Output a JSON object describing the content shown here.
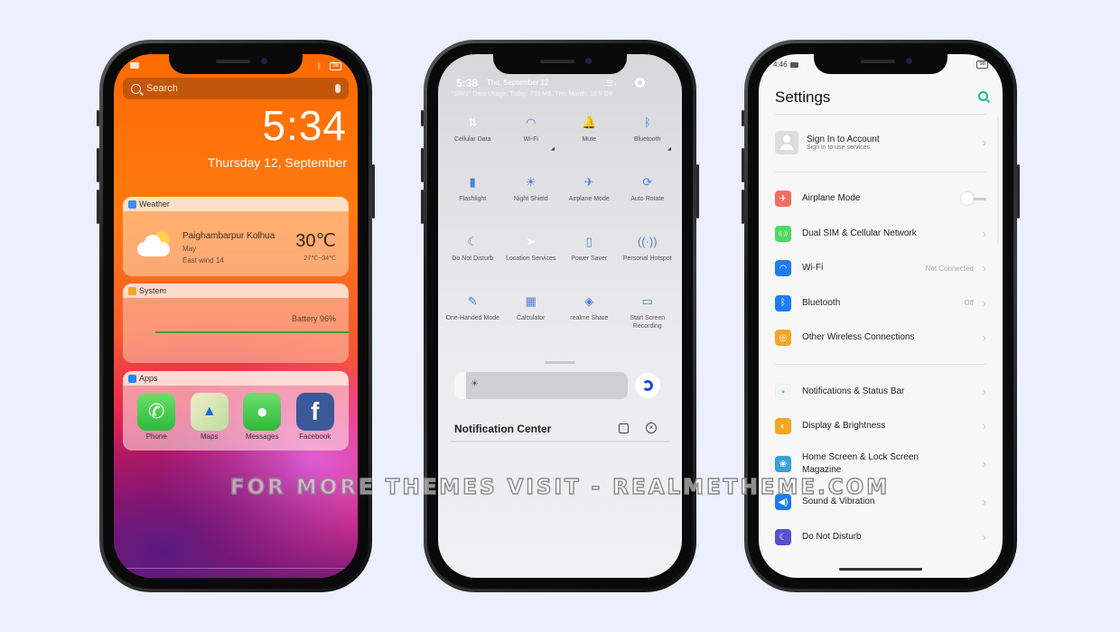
{
  "watermark": "FOR MORE THEMES VISIT - REALMETHEME.COM",
  "phone1": {
    "status": {
      "battery": "96",
      "bluetooth_icon": "bluetooth-icon"
    },
    "search": {
      "placeholder": "Search"
    },
    "clock": "5:34",
    "date": "Thursday 12, September",
    "weather": {
      "header": "Weather",
      "city": "Paighambarpur Kolhua",
      "condition": "May",
      "wind": "East wind 14",
      "temperature": "30℃",
      "range": "27℃~34℃"
    },
    "system": {
      "header": "System",
      "battery_label": "Battery 96%",
      "battery_percent": 96
    },
    "apps": {
      "header": "Apps",
      "items": [
        {
          "label": "Phone",
          "icon": "phone-icon",
          "color": "#34c759"
        },
        {
          "label": "Maps",
          "icon": "maps-icon",
          "color": "#f2e7c8"
        },
        {
          "label": "Messages",
          "icon": "messages-icon",
          "color": "#34c759"
        },
        {
          "label": "Facebook",
          "icon": "facebook-icon",
          "color": "#3b5998"
        }
      ]
    }
  },
  "phone2": {
    "time": "5:38",
    "date": "Thu, September 12",
    "data_usage": "\"SIM1\" Data Usage, Today: 733 MB, This Month: 10.5 GB",
    "tiles": [
      {
        "label": "Cellular Data",
        "glyph": "⇅",
        "icon": "cellular-data-icon",
        "active": false
      },
      {
        "label": "Wi-Fi",
        "glyph": "◠",
        "icon": "wifi-icon",
        "active": true,
        "more": true
      },
      {
        "label": "Mute",
        "glyph": "🔔",
        "icon": "mute-icon",
        "active": true
      },
      {
        "label": "Bluetooth",
        "glyph": "ᛒ",
        "icon": "bluetooth-icon",
        "active": true,
        "more": true
      },
      {
        "label": "Flashlight",
        "glyph": "▮",
        "icon": "flashlight-icon",
        "active": true
      },
      {
        "label": "Night Shield",
        "glyph": "☀",
        "icon": "night-shield-icon",
        "active": true
      },
      {
        "label": "Airplane Mode",
        "glyph": "✈",
        "icon": "airplane-icon",
        "active": true
      },
      {
        "label": "Auto Rotate",
        "glyph": "⟳",
        "icon": "auto-rotate-icon",
        "active": true
      },
      {
        "label": "Do Not Disturb",
        "glyph": "☾",
        "icon": "moon-icon",
        "active": true
      },
      {
        "label": "Location Services",
        "glyph": "➤",
        "icon": "location-icon",
        "active": false
      },
      {
        "label": "Power Saver",
        "glyph": "▯",
        "icon": "battery-icon",
        "active": true
      },
      {
        "label": "Personal Hotspot",
        "glyph": "((·))",
        "icon": "hotspot-icon",
        "active": true
      },
      {
        "label": "One-Handed Mode",
        "glyph": "✎",
        "icon": "one-handed-icon",
        "active": true
      },
      {
        "label": "Calculator",
        "glyph": "▦",
        "icon": "calculator-icon",
        "active": true
      },
      {
        "label": "realme Share",
        "glyph": "◈",
        "icon": "realme-share-icon",
        "active": true
      },
      {
        "label": "Start Screen Recording",
        "glyph": "▭",
        "icon": "screen-record-icon",
        "active": true
      }
    ],
    "brightness_percent": 7,
    "notification_center": "Notification Center"
  },
  "phone3": {
    "status": {
      "time": "4:46",
      "battery": "98"
    },
    "title": "Settings",
    "account": {
      "title": "Sign In to Account",
      "subtitle": "Sign in to use services."
    },
    "group1": [
      {
        "label": "Airplane Mode",
        "icon": "airplane-icon",
        "glyph": "✈",
        "color": "#ef6f62",
        "toggle": false
      },
      {
        "label": "Dual SIM & Cellular Network",
        "icon": "cellular-icon",
        "glyph": "((·))",
        "color": "#4cd964"
      },
      {
        "label": "Wi-Fi",
        "icon": "wifi-icon",
        "glyph": "◠",
        "color": "#1e7cf2",
        "value": "Not Connected"
      },
      {
        "label": "Bluetooth",
        "icon": "bluetooth-icon",
        "glyph": "ᛒ",
        "color": "#1e7cf2",
        "value": "Off"
      },
      {
        "label": "Other Wireless Connections",
        "icon": "wireless-icon",
        "glyph": "◎",
        "color": "#f5a623"
      }
    ],
    "group2": [
      {
        "label": "Notifications & Status Bar",
        "icon": "notifications-icon",
        "glyph": "▪",
        "color": "#f4f4f4"
      },
      {
        "label": "Display & Brightness",
        "icon": "display-icon",
        "glyph": "◐",
        "color": "#f5a623"
      },
      {
        "label": "Home Screen & Lock Screen Magazine",
        "icon": "home-screen-icon",
        "glyph": "❀",
        "color": "#3aa0d8"
      },
      {
        "label": "Sound & Vibration",
        "icon": "sound-icon",
        "glyph": "◀)",
        "color": "#1e7cf2"
      },
      {
        "label": "Do Not Disturb",
        "icon": "moon-icon",
        "glyph": "☾",
        "color": "#5b4fd0"
      }
    ]
  }
}
